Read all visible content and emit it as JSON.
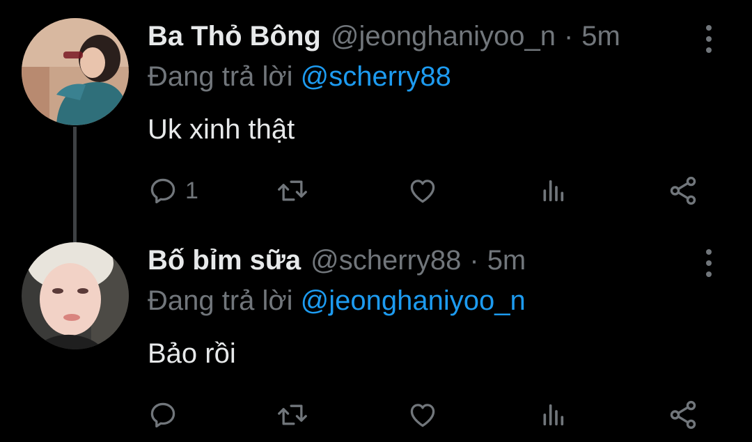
{
  "colors": {
    "background": "#000000",
    "primary_text": "#e7e9ea",
    "secondary_text": "#71767b",
    "link": "#1d9bf0",
    "thread_line": "#3e4144"
  },
  "tweets": [
    {
      "display_name": "Ba Thỏ Bông",
      "handle": "@jeonghaniyoo_n",
      "separator": "·",
      "time": "5m",
      "reply_prefix": "Đang trả lời",
      "reply_to": "@scherry88",
      "text": "Uk xinh thật",
      "reply_count": "1",
      "icons": [
        "reply-icon",
        "retweet-icon",
        "like-icon",
        "views-icon",
        "share-icon",
        "more-icon"
      ]
    },
    {
      "display_name": "Bố bỉm sữa",
      "handle": "@scherry88",
      "separator": "·",
      "time": "5m",
      "reply_prefix": "Đang trả lời",
      "reply_to": "@jeonghaniyoo_n",
      "text": "Bảo rồi",
      "reply_count": "",
      "icons": [
        "reply-icon",
        "retweet-icon",
        "like-icon",
        "views-icon",
        "share-icon",
        "more-icon"
      ]
    }
  ]
}
